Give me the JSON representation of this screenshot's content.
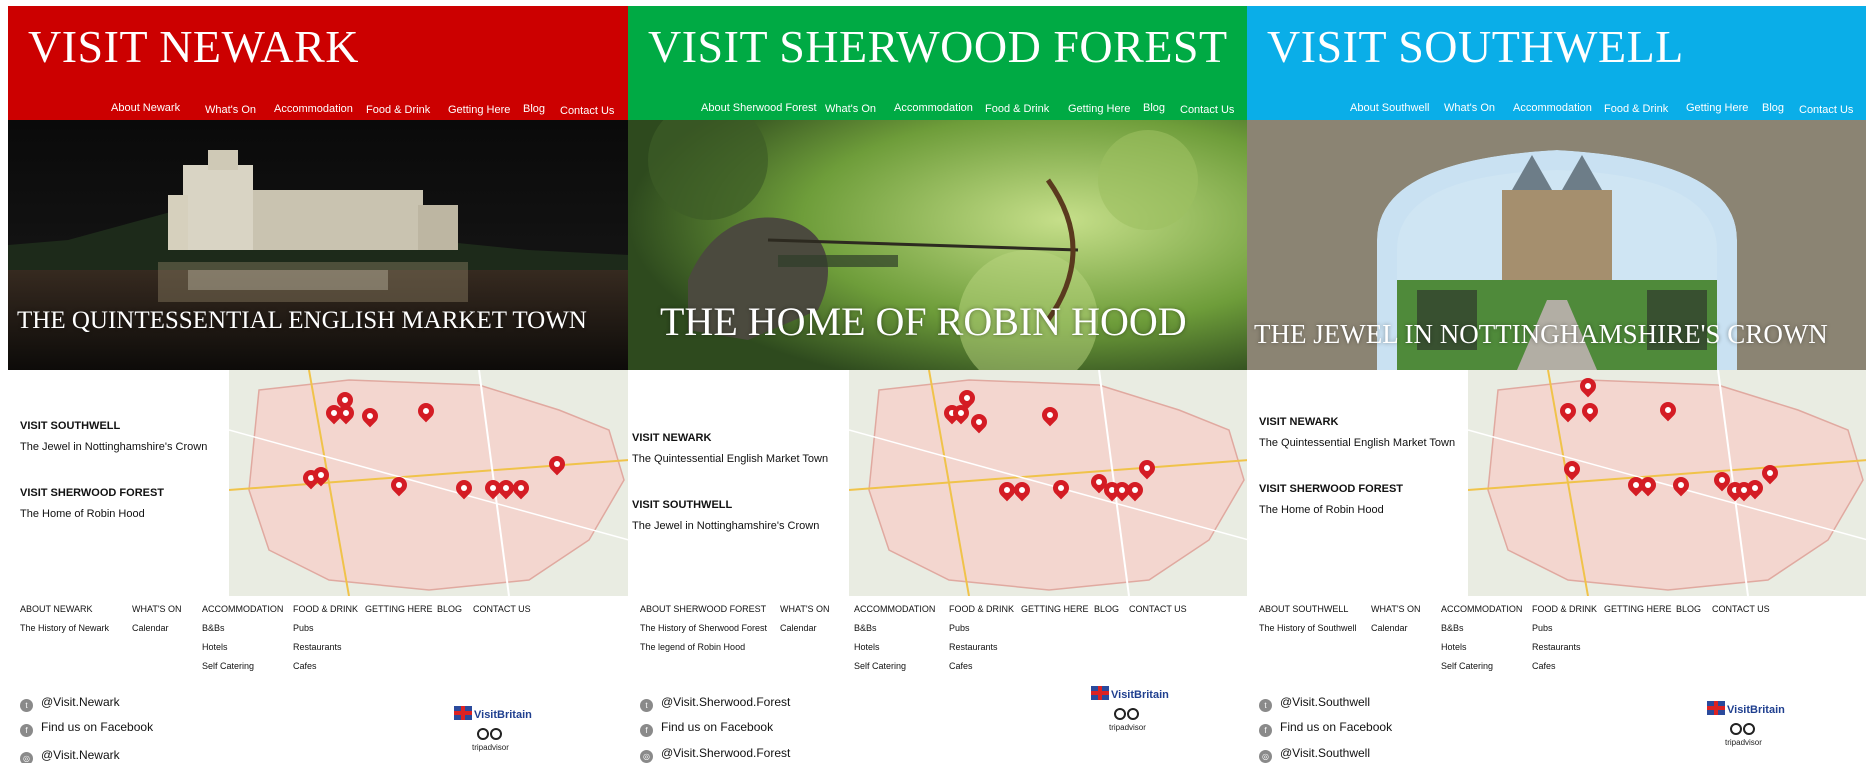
{
  "panels": [
    {
      "key": "newark",
      "colors": {
        "header": "#cc0000"
      },
      "title": "VISIT NEWARK",
      "nav": [
        "About Newark",
        "What's On",
        "Accommodation",
        "Food & Drink",
        "Getting Here",
        "Blog",
        "Contact Us"
      ],
      "hero_caption": "THE QUINTESSENTIAL ENGLISH MARKET TOWN",
      "side": [
        {
          "title": "VISIT SOUTHWELL",
          "sub": "The Jewel in Nottinghamshire's Crown"
        },
        {
          "title": "VISIT SHERWOOD FOREST",
          "sub": "The Home of Robin Hood"
        }
      ],
      "footer_cols": [
        {
          "head": "ABOUT NEWARK",
          "items": [
            "The History of Newark"
          ]
        },
        {
          "head": "WHAT'S ON",
          "items": [
            "Calendar"
          ]
        },
        {
          "head": "ACCOMMODATION",
          "items": [
            "B&Bs",
            "Hotels",
            "Self Catering"
          ]
        },
        {
          "head": "FOOD & DRINK",
          "items": [
            "Pubs",
            "Restaurants",
            "Cafes"
          ]
        },
        {
          "head": "GETTING HERE",
          "items": []
        },
        {
          "head": "BLOG",
          "items": []
        },
        {
          "head": "CONTACT US",
          "items": []
        }
      ],
      "social": [
        "@Visit.Newark",
        "Find us on Facebook",
        "@Visit.Newark"
      ],
      "visitbritain": "VisitBritain",
      "tripadvisor": "tripadvisor"
    },
    {
      "key": "sherwood",
      "colors": {
        "header": "#00aa44"
      },
      "title": "VISIT SHERWOOD FOREST",
      "nav": [
        "About Sherwood Forest",
        "What's On",
        "Accommodation",
        "Food & Drink",
        "Getting Here",
        "Blog",
        "Contact Us"
      ],
      "hero_caption": "THE HOME OF ROBIN HOOD",
      "side": [
        {
          "title": "VISIT NEWARK",
          "sub": "The Quintessential English Market Town"
        },
        {
          "title": "VISIT SOUTHWELL",
          "sub": "The Jewel in Nottinghamshire's Crown"
        }
      ],
      "footer_cols": [
        {
          "head": "ABOUT SHERWOOD FOREST",
          "items": [
            "The History of Sherwood Forest",
            "The legend of Robin Hood"
          ]
        },
        {
          "head": "WHAT'S ON",
          "items": [
            "Calendar"
          ]
        },
        {
          "head": "ACCOMMODATION",
          "items": [
            "B&Bs",
            "Hotels",
            "Self Catering"
          ]
        },
        {
          "head": "FOOD & DRINK",
          "items": [
            "Pubs",
            "Restaurants",
            "Cafes"
          ]
        },
        {
          "head": "GETTING HERE",
          "items": []
        },
        {
          "head": "BLOG",
          "items": []
        },
        {
          "head": "CONTACT US",
          "items": []
        }
      ],
      "social": [
        "@Visit.Sherwood.Forest",
        "Find us on Facebook",
        "@Visit.Sherwood.Forest"
      ],
      "visitbritain": "VisitBritain",
      "tripadvisor": "tripadvisor"
    },
    {
      "key": "southwell",
      "colors": {
        "header": "#0aaee8"
      },
      "title": "VISIT SOUTHWELL",
      "nav": [
        "About Southwell",
        "What's On",
        "Accommodation",
        "Food & Drink",
        "Getting Here",
        "Blog",
        "Contact Us"
      ],
      "hero_caption": "THE JEWEL IN NOTTINGHAMSHIRE'S CROWN",
      "side": [
        {
          "title": "VISIT NEWARK",
          "sub": "The Quintessential English Market Town"
        },
        {
          "title": "VISIT SHERWOOD FOREST",
          "sub": "The Home of Robin Hood"
        }
      ],
      "footer_cols": [
        {
          "head": "ABOUT SOUTHWELL",
          "items": [
            "The History of Southwell"
          ]
        },
        {
          "head": "WHAT'S ON",
          "items": [
            "Calendar"
          ]
        },
        {
          "head": "ACCOMMODATION",
          "items": [
            "B&Bs",
            "Hotels",
            "Self Catering"
          ]
        },
        {
          "head": "FOOD & DRINK",
          "items": [
            "Pubs",
            "Restaurants",
            "Cafes"
          ]
        },
        {
          "head": "GETTING HERE",
          "items": []
        },
        {
          "head": "BLOG",
          "items": []
        },
        {
          "head": "CONTACT US",
          "items": []
        }
      ],
      "social": [
        "@Visit.Southwell",
        "Find us on Facebook",
        "@Visit.Southwell"
      ],
      "visitbritain": "VisitBritain",
      "tripadvisor": "tripadvisor"
    }
  ]
}
